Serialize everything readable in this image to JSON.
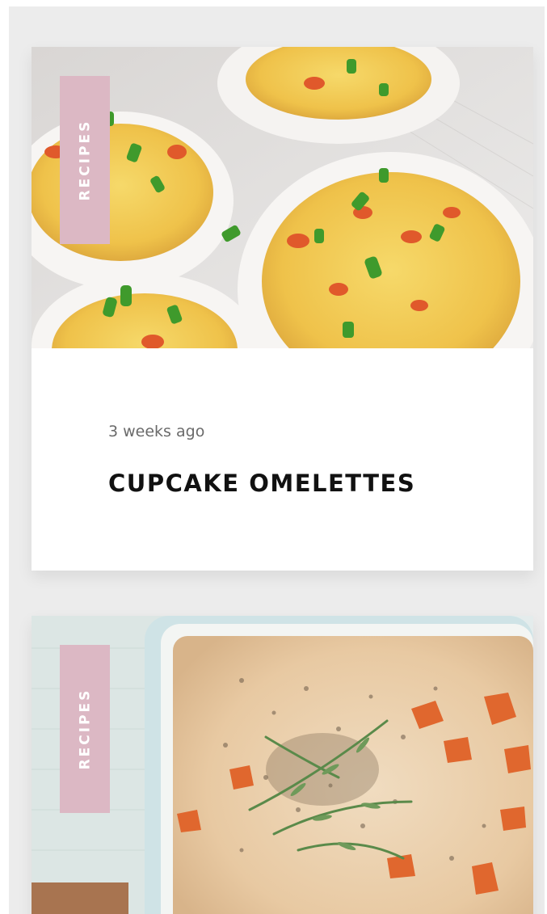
{
  "posts": [
    {
      "category": "RECIPES",
      "date": "3 weeks ago",
      "title": "CUPCAKE OMELETTES",
      "image": "cupcake-omelettes-photo"
    },
    {
      "category": "RECIPES",
      "image": "baked-casserole-photo"
    }
  ],
  "colors": {
    "background": "#ececec",
    "card": "#ffffff",
    "tag": "#dcb8c4",
    "title": "#111111",
    "date": "#6a6a6a"
  }
}
